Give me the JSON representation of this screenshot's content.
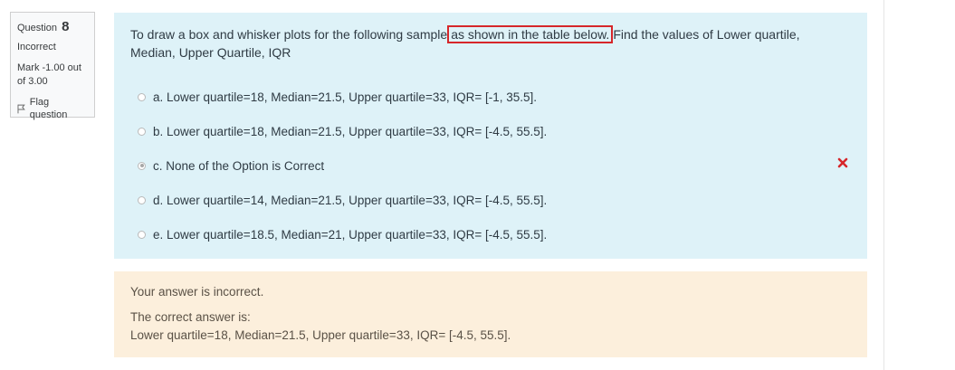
{
  "info": {
    "question_label": "Question",
    "question_number": "8",
    "state": "Incorrect",
    "grade": "Mark -1.00 out of 3.00",
    "flag_label": "Flag question"
  },
  "question": {
    "text_before": "To draw a box and whisker plots for the following sample",
    "text_highlight": "as shown in the table below.",
    "text_after": "Find the values of Lower quartile, Median, Upper Quartile, IQR"
  },
  "answers": [
    {
      "label": "a. Lower quartile=18, Median=21.5, Upper quartile=33, IQR= [-1, 35.5].",
      "checked": false
    },
    {
      "label": "b. Lower quartile=18, Median=21.5, Upper quartile=33, IQR= [-4.5, 55.5].",
      "checked": false
    },
    {
      "label": "c. None of the Option is Correct",
      "checked": true
    },
    {
      "label": "d. Lower quartile=14, Median=21.5, Upper quartile=33, IQR= [-4.5, 55.5].",
      "checked": false
    },
    {
      "label": "e. Lower quartile=18.5, Median=21, Upper quartile=33, IQR= [-4.5, 55.5].",
      "checked": false
    }
  ],
  "feedback": {
    "result": "Your answer is incorrect.",
    "correct_intro": "The correct answer is:",
    "correct_answer": "Lower quartile=18, Median=21.5, Upper quartile=33, IQR= [-4.5, 55.5]."
  },
  "colors": {
    "formulation_bg": "#def2f8",
    "feedback_bg": "#fcefdc",
    "highlight_border": "#d6262a",
    "incorrect_mark": "#d6262a"
  }
}
